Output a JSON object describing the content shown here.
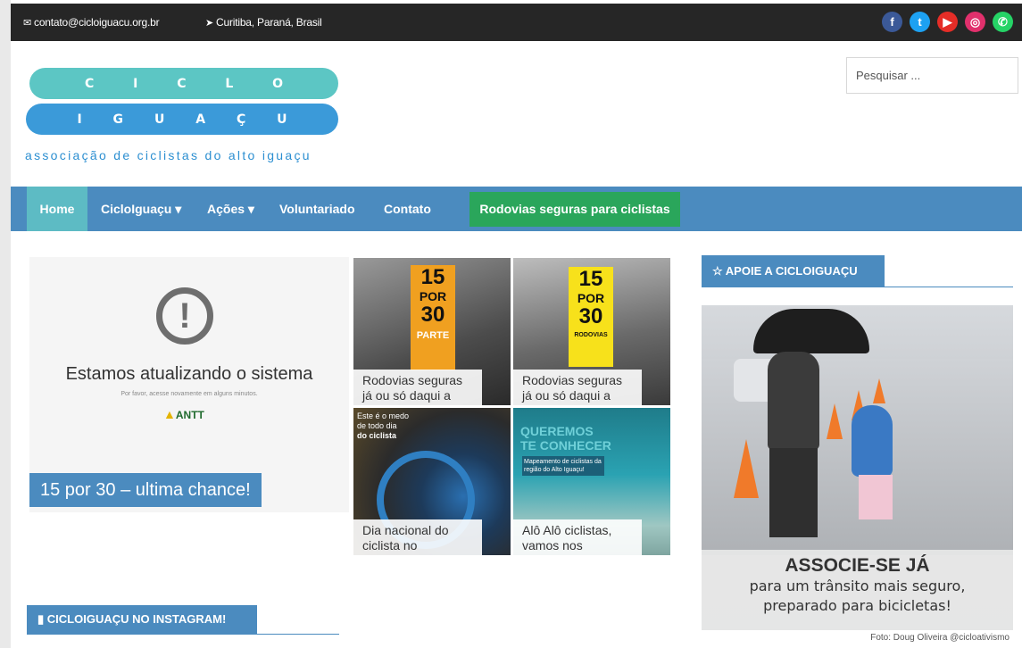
{
  "topbar": {
    "email": "contato@cicloiguacu.org.br",
    "location": "Curitiba, Paraná, Brasil",
    "socials": [
      {
        "icon": "facebook-icon",
        "glyph": "f",
        "color": "#3b5998"
      },
      {
        "icon": "twitter-icon",
        "glyph": "t",
        "color": "#1da1f2"
      },
      {
        "icon": "youtube-icon",
        "glyph": "▶",
        "color": "#e52d27"
      },
      {
        "icon": "instagram-icon",
        "glyph": "◎",
        "color": "#e1306c"
      },
      {
        "icon": "whatsapp-icon",
        "glyph": "✆",
        "color": "#25d366"
      }
    ]
  },
  "logo": {
    "line1": [
      "C",
      "I",
      "C",
      "L",
      "O"
    ],
    "line2": [
      "I",
      "G",
      "U",
      "A",
      "Ç",
      "U"
    ],
    "tagline": "associação de ciclistas do alto iguaçu"
  },
  "search": {
    "placeholder": "Pesquisar ..."
  },
  "nav": {
    "home": "Home",
    "cicloiguacu": "CicloIguaçu",
    "acoes": "Ações",
    "voluntariado": "Voluntariado",
    "contato": "Contato",
    "cta": "Rodovias seguras para ciclistas"
  },
  "slide": {
    "message": "Estamos atualizando o sistema",
    "submessage": "Por favor, acesse novamente em alguns minutos.",
    "antt": "ANTT",
    "caption": "15 por 30 – ultima chance!"
  },
  "tiles": [
    {
      "caption": "Rodovias seguras já ou só daqui a",
      "badge": [
        "15",
        "POR",
        "30",
        "PARTE"
      ]
    },
    {
      "caption": "Rodovias seguras já ou só daqui a",
      "badge": [
        "15",
        "POR",
        "30",
        "RODOVIAS"
      ]
    },
    {
      "caption": "Dia nacional do ciclista no",
      "overlay": [
        "Este é o medo",
        "de todo dia",
        "do ciclista"
      ]
    },
    {
      "caption": "Alô Alô ciclistas, vamos nos",
      "overlay": [
        "QUEREMOS",
        "TE CONHECER",
        "Mapeamento de ciclistas da região do Alto Iguaçu!"
      ]
    }
  ],
  "sidebar": {
    "heading": "APOIE A CICLOIGUAÇU",
    "big": "ASSOCIE-SE JÁ",
    "line1": "para um trânsito mais seguro,",
    "line2": "preparado para bicicletas!",
    "credit": "Foto: Doug Oliveira @cicloativismo"
  },
  "instagram": {
    "heading": "CICLOIGUAÇU NO INSTAGRAM!"
  }
}
